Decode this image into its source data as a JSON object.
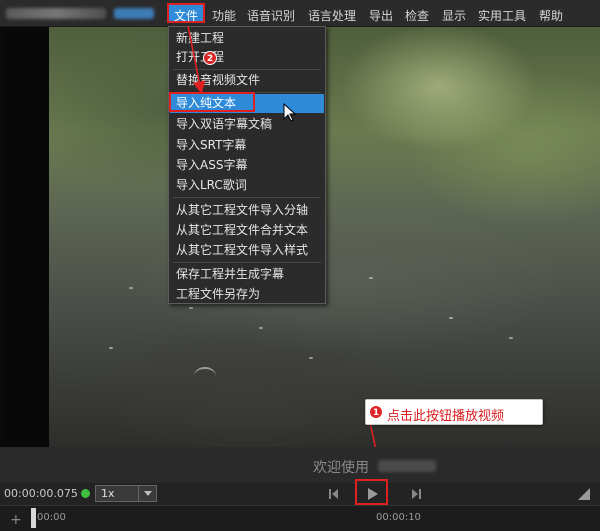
{
  "menubar": {
    "items": [
      {
        "label": "文件",
        "active": true
      },
      {
        "label": "功能"
      },
      {
        "label": "语音识别"
      },
      {
        "label": "语言处理"
      },
      {
        "label": "导出"
      },
      {
        "label": "检查"
      },
      {
        "label": "显示"
      },
      {
        "label": "实用工具"
      },
      {
        "label": "帮助"
      }
    ]
  },
  "file_menu": {
    "items": [
      {
        "label": "新建工程"
      },
      {
        "label": "打开工程"
      },
      {
        "label": "替换音视频文件"
      },
      {
        "label": "导入纯文本",
        "highlighted": true
      },
      {
        "label": "导入双语字幕文稿"
      },
      {
        "label": "导入SRT字幕"
      },
      {
        "label": "导入ASS字幕"
      },
      {
        "label": "导入LRC歌词"
      },
      {
        "label": "从其它工程文件导入分轴"
      },
      {
        "label": "从其它工程文件合并文本"
      },
      {
        "label": "从其它工程文件导入样式"
      },
      {
        "label": "保存工程并生成字幕"
      },
      {
        "label": "工程文件另存为"
      }
    ]
  },
  "annotations": {
    "badge1": "1",
    "badge2": "2",
    "callout1": "点击此按钮播放视频",
    "accent_color": "#e02020"
  },
  "subtitle_bar": {
    "welcome_text": "欢迎使用"
  },
  "controls": {
    "timecode": "00:00:00.075",
    "speed": "1x"
  },
  "timeline": {
    "ticks": [
      "00:00",
      "00:00:10"
    ]
  },
  "colors": {
    "menu_highlight": "#2f8bd8",
    "annotation_red": "#e02020",
    "status_green": "#3fbf3f"
  }
}
